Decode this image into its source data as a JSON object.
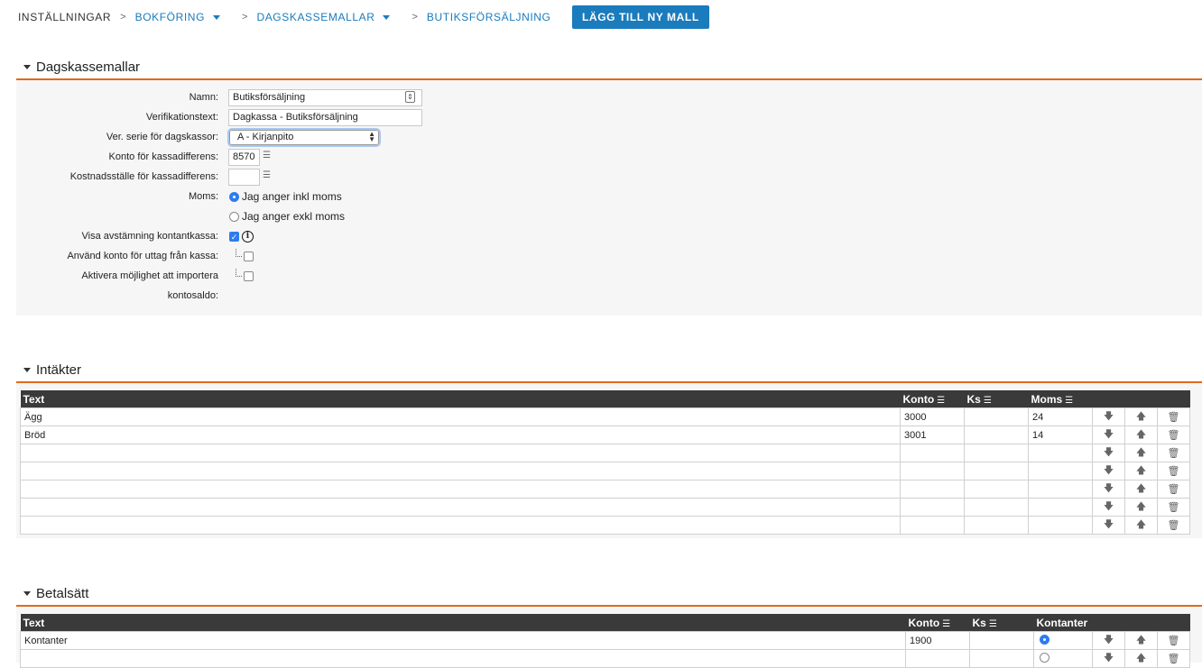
{
  "breadcrumb": {
    "root": "INSTÄLLNINGAR",
    "sep": ">",
    "items": [
      "BOKFÖRING",
      "DAGSKASSEMALLAR",
      "BUTIKSFÖRSÄLJNING"
    ],
    "add_button": "LÄGG TILL NY MALL"
  },
  "sections": {
    "dagskassemallar": "Dagskassemallar",
    "intakter": "Intäkter",
    "betalsatt": "Betalsätt"
  },
  "form": {
    "namn_label": "Namn:",
    "namn_value": "Butiksförsäljning",
    "verif_label": "Verifikationstext:",
    "verif_value": "Dagkassa - Butiksförsäljning",
    "serie_label": "Ver. serie för dagskassor:",
    "serie_value": "A - Kirjanpito",
    "konto_label": "Konto för kassadifferens:",
    "konto_value": "8570",
    "kostnad_label": "Kostnadsställe för kassadifferens:",
    "kostnad_value": "",
    "moms_label": "Moms:",
    "moms_option1": "Jag anger inkl moms",
    "moms_option2": "Jag anger exkl moms",
    "visa_label": "Visa avstämning kontantkassa:",
    "anvand_label": "Använd konto för uttag från kassa:",
    "aktivera_label1": "Aktivera möjlighet att importera",
    "aktivera_label2": "kontosaldo:"
  },
  "intakter": {
    "headers": {
      "text": "Text",
      "konto": "Konto",
      "ks": "Ks",
      "moms": "Moms"
    },
    "rows": [
      {
        "text": "Ägg",
        "konto": "3000",
        "ks": "",
        "moms": "24"
      },
      {
        "text": "Bröd",
        "konto": "3001",
        "ks": "",
        "moms": "14"
      },
      {
        "text": "",
        "konto": "",
        "ks": "",
        "moms": ""
      },
      {
        "text": "",
        "konto": "",
        "ks": "",
        "moms": ""
      },
      {
        "text": "",
        "konto": "",
        "ks": "",
        "moms": ""
      },
      {
        "text": "",
        "konto": "",
        "ks": "",
        "moms": ""
      },
      {
        "text": "",
        "konto": "",
        "ks": "",
        "moms": ""
      }
    ]
  },
  "betalsatt": {
    "headers": {
      "text": "Text",
      "konto": "Konto",
      "ks": "Ks",
      "kontanter": "Kontanter"
    },
    "rows": [
      {
        "text": "Kontanter",
        "konto": "1900",
        "ks": "",
        "kontanter": true
      },
      {
        "text": "",
        "konto": "",
        "ks": "",
        "kontanter": false
      }
    ]
  },
  "icons": {
    "list": "list-icon",
    "down": "arrow-down-icon",
    "up": "arrow-up-icon",
    "delete": "trash-icon",
    "info": "info-icon",
    "expand": "triangle-down-icon",
    "dropdown": "caret-down-icon"
  },
  "colors": {
    "accent": "#1a7bbd",
    "section_rule": "#e06a1c",
    "table_header": "#3a3a3a",
    "radio_checked": "#2d7cf0"
  }
}
